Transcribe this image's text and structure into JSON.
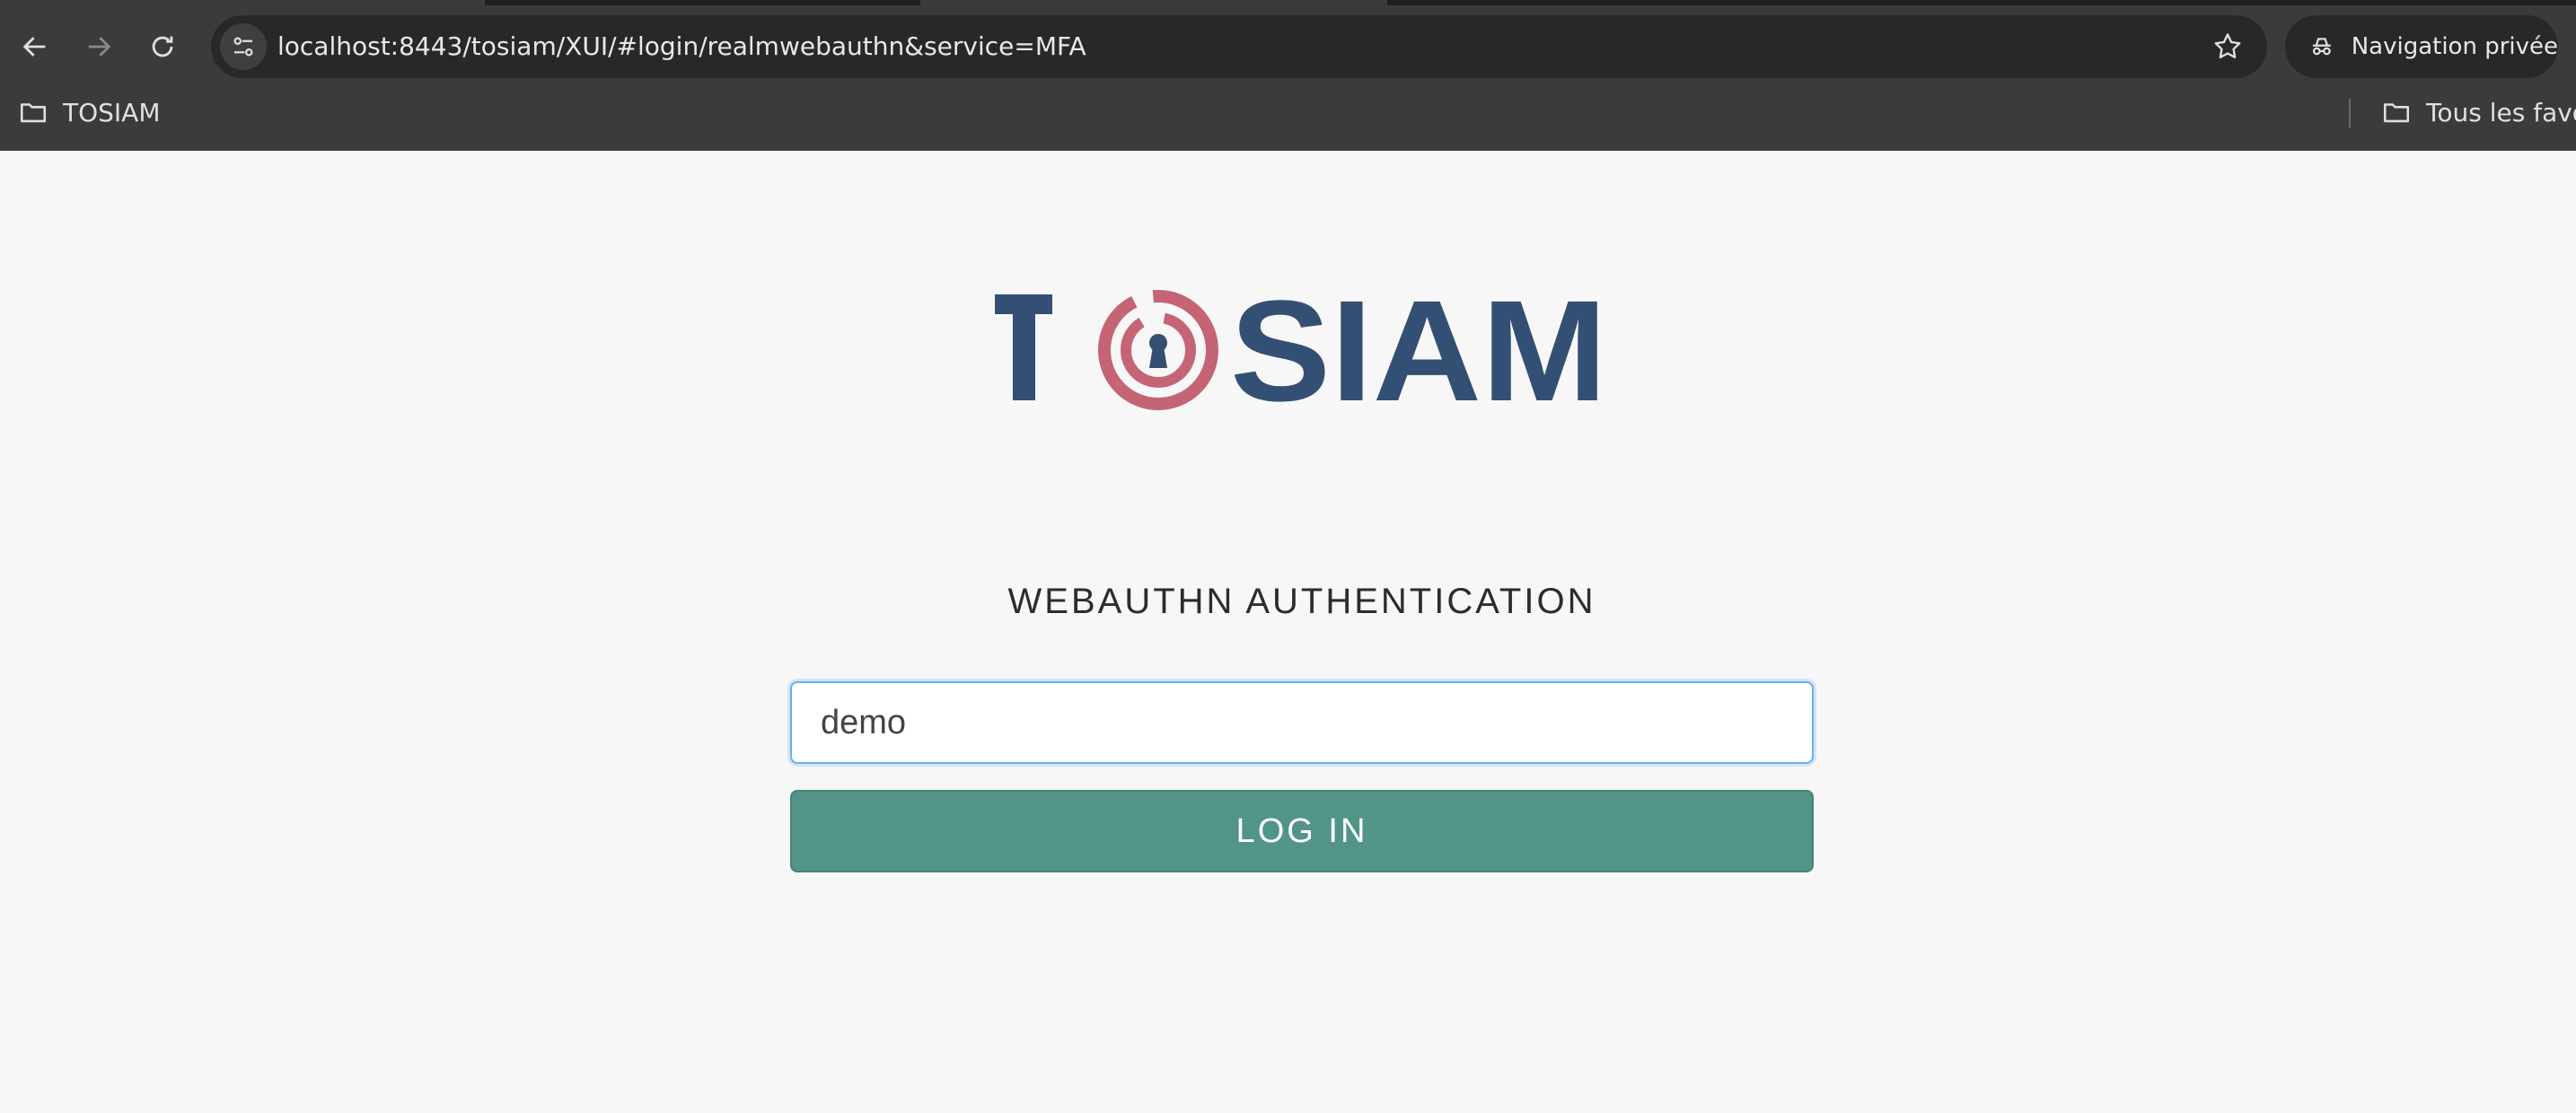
{
  "browser": {
    "url": "localhost:8443/tosiam/XUI/#login/realmwebauthn&service=MFA",
    "incognito_label": "Navigation privée",
    "bookmarks": [
      {
        "label": "TOSIAM"
      },
      {
        "label": "Tous les favoris"
      }
    ]
  },
  "page": {
    "logo_text": "TOSIAM",
    "heading": "WEBAUTHN AUTHENTICATION",
    "username_value": "demo",
    "login_label": "LOG IN"
  },
  "colors": {
    "logo_blue": "#344f74",
    "logo_red": "#c46474",
    "button_green": "#529488",
    "input_focus": "#6aaef0"
  },
  "icons": {
    "back": "arrow-left-icon",
    "forward": "arrow-right-icon",
    "reload": "reload-icon",
    "site_info": "tune-icon",
    "bookmark_star": "star-icon",
    "incognito": "incognito-icon",
    "folder": "folder-icon"
  }
}
